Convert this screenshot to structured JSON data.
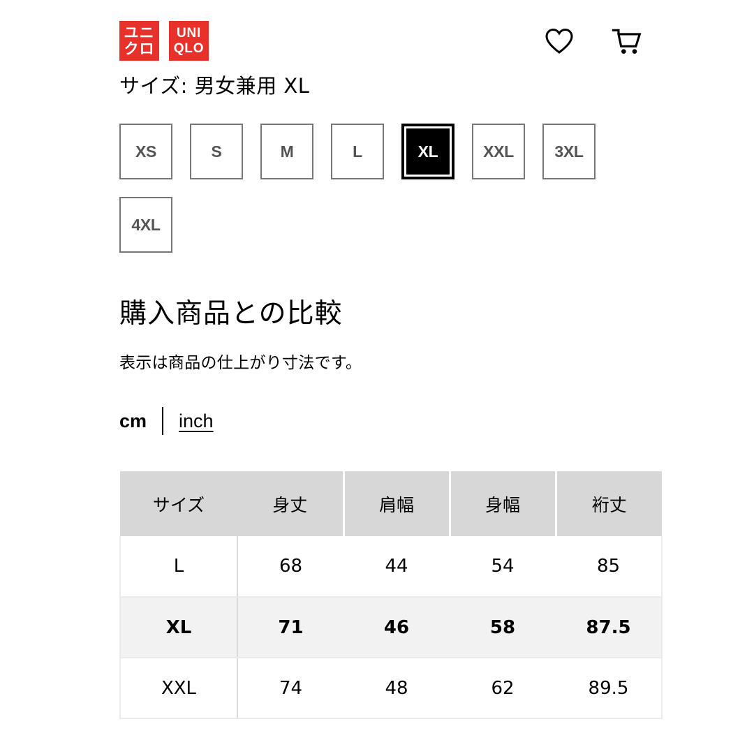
{
  "header": {
    "logo_jp_line1": "ユニ",
    "logo_jp_line2": "クロ",
    "logo_en_line1": "UNI",
    "logo_en_line2": "QLO",
    "brand_color": "#e8312a",
    "wishlist_icon": "heart-icon",
    "cart_icon": "shopping-cart-icon"
  },
  "size_selector": {
    "label": "サイズ: 男女兼用 XL",
    "selected": "XL",
    "options": [
      {
        "label": "XS",
        "selected": false
      },
      {
        "label": "S",
        "selected": false
      },
      {
        "label": "M",
        "selected": false
      },
      {
        "label": "L",
        "selected": false
      },
      {
        "label": "XL",
        "selected": true
      },
      {
        "label": "XXL",
        "selected": false
      },
      {
        "label": "3XL",
        "selected": false
      },
      {
        "label": "4XL",
        "selected": false
      }
    ]
  },
  "comparison": {
    "title": "購入商品との比較",
    "note": "表示は商品の仕上がり寸法です。",
    "units": {
      "active": "cm",
      "alternate": "inch"
    }
  },
  "size_table": {
    "columns": [
      "サイズ",
      "身丈",
      "肩幅",
      "身幅",
      "裄丈"
    ],
    "rows": [
      {
        "size": "L",
        "values": [
          "68",
          "44",
          "54",
          "85"
        ],
        "highlight": false
      },
      {
        "size": "XL",
        "values": [
          "71",
          "46",
          "58",
          "87.5"
        ],
        "highlight": true
      },
      {
        "size": "XXL",
        "values": [
          "74",
          "48",
          "62",
          "89.5"
        ],
        "highlight": false
      }
    ]
  }
}
